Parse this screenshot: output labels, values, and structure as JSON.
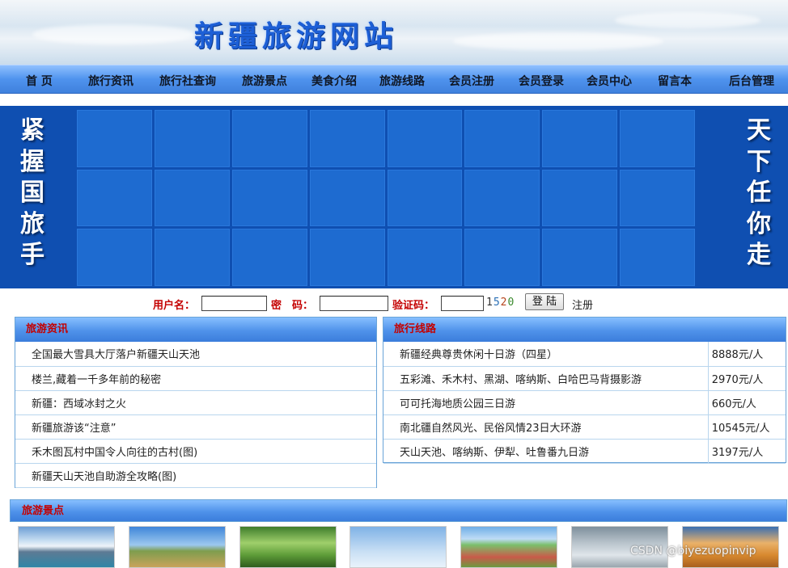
{
  "header": {
    "title": "新疆旅游网站"
  },
  "nav": {
    "items": [
      "首 页",
      "旅行资讯",
      "旅行社查询",
      "旅游景点",
      "美食介绍",
      "旅游线路",
      "会员注册",
      "会员登录",
      "会员中心",
      "留言本",
      "后台管理"
    ]
  },
  "banner": {
    "left_text": "紧握国旅手",
    "right_text": "天下任你走"
  },
  "login": {
    "username_label": "用户名：",
    "password_label": "密　码：",
    "captcha_label": "验证码：",
    "captcha_code": "1520",
    "submit_label": "登 陆",
    "register_label": "注册"
  },
  "news": {
    "title": "旅游资讯",
    "items": [
      "全国最大雪具大厅落户新疆天山天池",
      "楼兰,藏着一千多年前的秘密",
      "新疆：西域冰封之火",
      "新疆旅游该“注意”",
      "禾木图瓦村中国令人向往的古村(图)",
      "新疆天山天池自助游全攻略(图)"
    ]
  },
  "routes": {
    "title": "旅行线路",
    "items": [
      {
        "name": "新疆经典尊贵休闲十日游（四星）",
        "price": "8888元/人"
      },
      {
        "name": "五彩滩、禾木村、黑湖、喀纳斯、白哈巴马背摄影游",
        "price": "2970元/人"
      },
      {
        "name": "可可托海地质公园三日游",
        "price": "660元/人"
      },
      {
        "name": "南北疆自然风光、民俗风情23日大环游",
        "price": "10545元/人"
      },
      {
        "name": "天山天池、喀纳斯、伊犁、吐鲁番九日游",
        "price": "3197元/人"
      }
    ]
  },
  "scenic": {
    "title": "旅游景点"
  },
  "watermark": "CSDN @biyezuopinvip",
  "colors": {
    "nav_blue": "#4f93ee",
    "banner_blue": "#0f4fb1",
    "label_red": "#c40000"
  }
}
